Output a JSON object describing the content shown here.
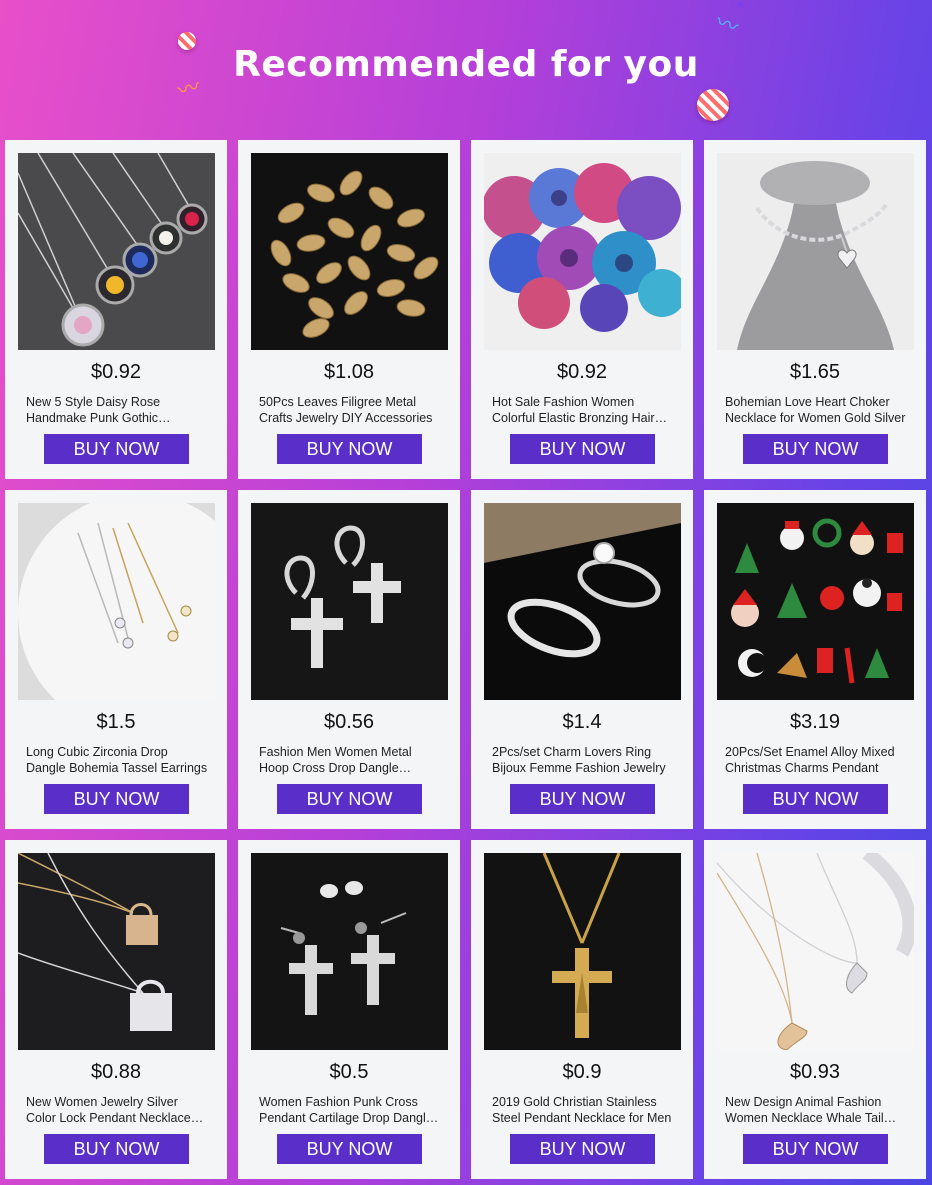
{
  "header": {
    "title": "Recommended for you"
  },
  "button_label": "BUY NOW",
  "colors": {
    "accent": "#5a2ec9",
    "card_bg": "#f4f5f7",
    "gradient_start": "#e84fc9",
    "gradient_end": "#4a45e3"
  },
  "products": [
    {
      "price": "$0.92",
      "name": "New 5 Style Daisy Rose Handmake Punk Gothic Bohemia Glass Necklace",
      "image": "daisy-necklaces"
    },
    {
      "price": "$1.08",
      "name": "50Pcs Leaves Filigree Metal Crafts Jewelry DIY Accessories",
      "image": "gold-leaves"
    },
    {
      "price": "$0.92",
      "name": "Hot Sale Fashion Women Colorful Elastic Bronzing Hair Scrunchies",
      "image": "scrunchies"
    },
    {
      "price": "$1.65",
      "name": "Bohemian Love Heart Choker Necklace for Women Gold Silver",
      "image": "heart-choker"
    },
    {
      "price": "$1.5",
      "name": "Long Cubic Zirconia Drop Dangle Bohemia Tassel Earrings",
      "image": "drop-earrings"
    },
    {
      "price": "$0.56",
      "name": "Fashion Men Women Metal Hoop Cross Drop Dangle Earrings",
      "image": "cross-hoop-earrings"
    },
    {
      "price": "$1.4",
      "name": "2Pcs/set Charm Lovers Ring Bijoux Femme Fashion Jewelry",
      "image": "rings"
    },
    {
      "price": "$3.19",
      "name": "20Pcs/Set Enamel Alloy Mixed Christmas Charms Pendant",
      "image": "christmas-charms"
    },
    {
      "price": "$0.88",
      "name": "New Women Jewelry Silver Color Lock Pendant Necklace Chain",
      "image": "lock-necklace"
    },
    {
      "price": "$0.5",
      "name": "Women Fashion Punk Cross Pendant Cartilage Drop Dangle Earrings",
      "image": "cross-stud-earrings"
    },
    {
      "price": "$0.9",
      "name": "2019 Gold Christian Stainless Steel Pendant Necklace for Men",
      "image": "crucifix-necklace"
    },
    {
      "price": "$0.93",
      "name": "New Design Animal Fashion Women Necklace Whale Tail Pendant",
      "image": "whale-tail-necklace"
    }
  ]
}
